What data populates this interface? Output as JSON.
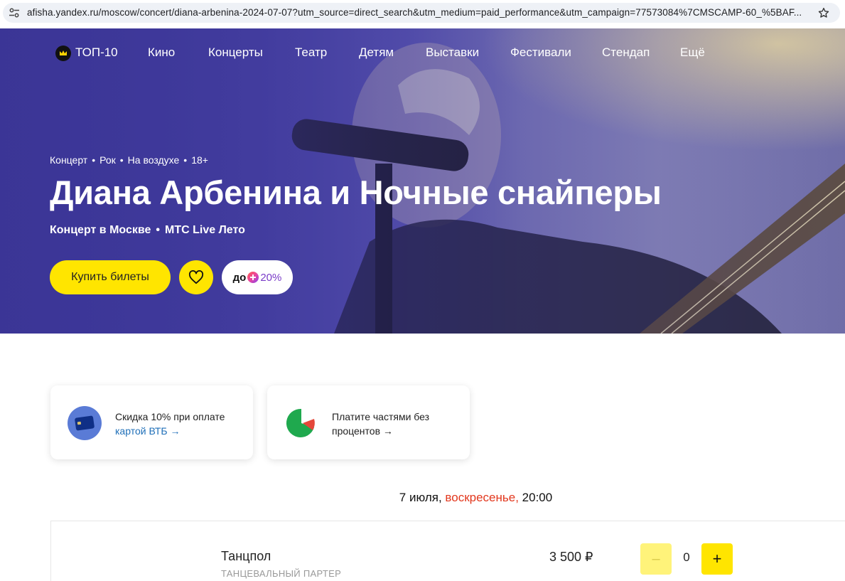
{
  "browser": {
    "url": "afisha.yandex.ru/moscow/concert/diana-arbenina-2024-07-07?utm_source=direct_search&utm_medium=paid_performance&utm_campaign=77573084%7CMSCAMP-60_%5BAF..."
  },
  "nav": {
    "items": [
      "ТОП-10",
      "Кино",
      "Концерты",
      "Театр",
      "Детям",
      "Выставки",
      "Фестивали",
      "Стендап",
      "Ещё"
    ]
  },
  "hero": {
    "tags": [
      "Концерт",
      "Рок",
      "На воздухе",
      "18+"
    ],
    "title": "Диана Арбенина и Ночные снайперы",
    "subtitle": [
      "Концерт в Москве",
      "МТС Live Лето"
    ],
    "buy_label": "Купить билеты",
    "plus_prefix": "до",
    "plus_percent": "20%"
  },
  "promos": [
    {
      "text": "Скидка 10% при оплате",
      "link": "картой ВТБ →"
    },
    {
      "text": "Платите частями без",
      "link": "процентов →"
    }
  ],
  "schedule": {
    "date": "7 июля,",
    "weekday": "воскресенье,",
    "time": "20:00"
  },
  "ticket": {
    "name": "Танцпол",
    "category": "ТАНЦЕВАЛЬНЫЙ ПАРТЕР",
    "price": "3 500 ₽",
    "quantity": "0",
    "minus_label": "–",
    "plus_label": "+"
  },
  "colors": {
    "accent_yellow": "#ffe500",
    "weekday_red": "#e2371d",
    "link_blue": "#1f6fb8",
    "plus_purple": "#7a3cc8"
  }
}
